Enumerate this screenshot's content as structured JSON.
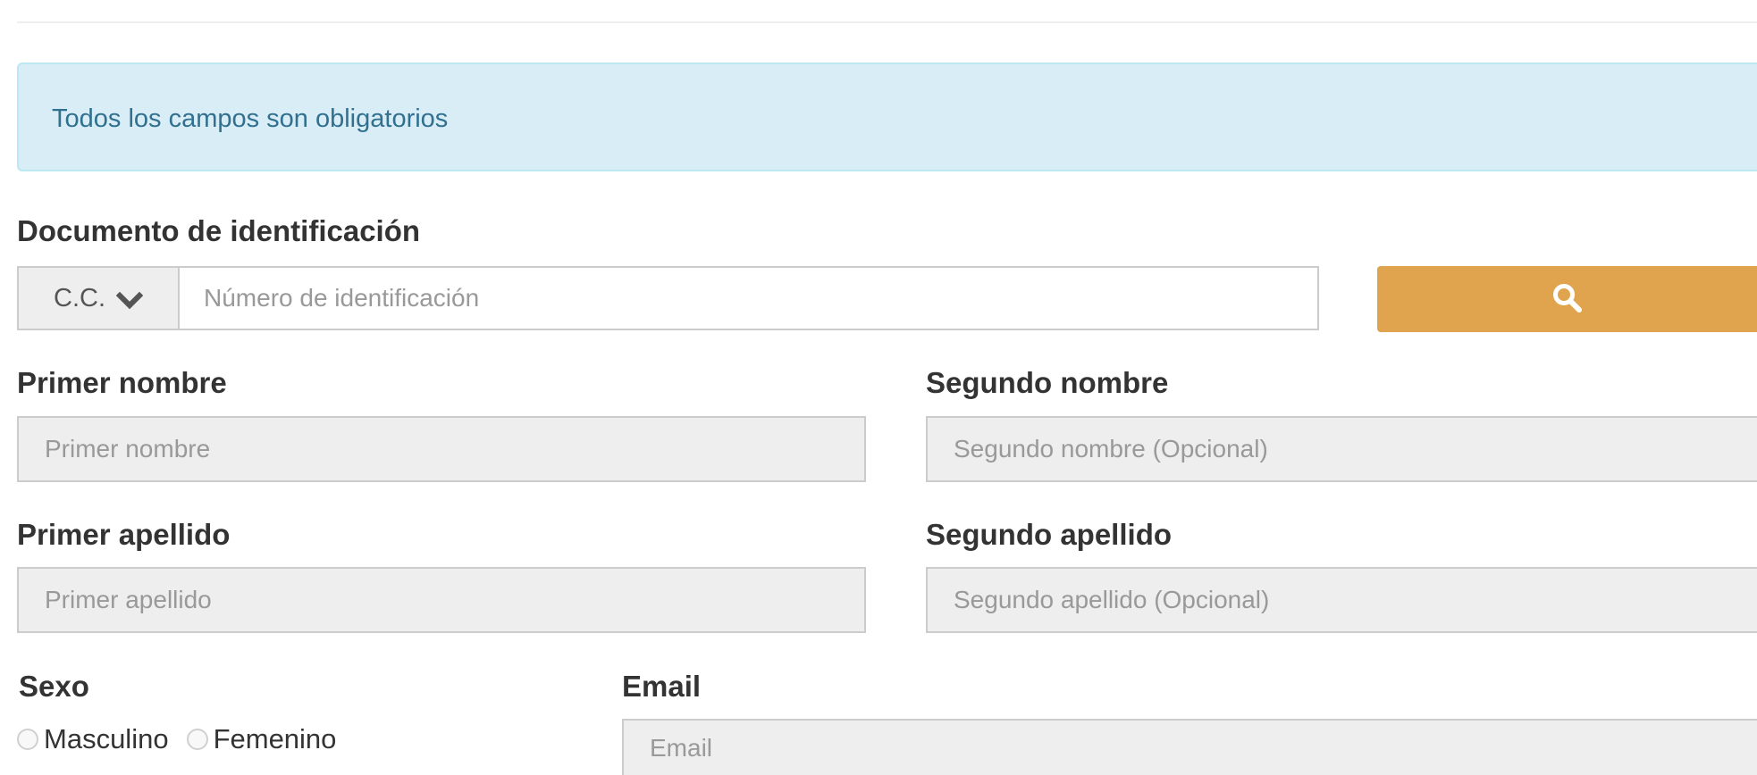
{
  "alert": {
    "text": "Todos los campos son obligatorios"
  },
  "document": {
    "label": "Documento de identificación",
    "type_selected": "C.C.",
    "number_placeholder": "Número de identificación",
    "number_value": "",
    "search_icon": "search-icon",
    "search_color": "#e0a44f"
  },
  "first_name": {
    "label": "Primer nombre",
    "placeholder": "Primer nombre",
    "value": ""
  },
  "second_name": {
    "label": "Segundo nombre",
    "placeholder": "Segundo nombre (Opcional)",
    "value": ""
  },
  "first_surname": {
    "label": "Primer apellido",
    "placeholder": "Primer apellido",
    "value": ""
  },
  "second_surname": {
    "label": "Segundo apellido",
    "placeholder": "Segundo apellido (Opcional)",
    "value": ""
  },
  "sex": {
    "label": "Sexo",
    "options": [
      {
        "label": "Masculino",
        "checked": false
      },
      {
        "label": "Femenino",
        "checked": false
      }
    ]
  },
  "email": {
    "label": "Email",
    "placeholder": "Email",
    "value": ""
  }
}
